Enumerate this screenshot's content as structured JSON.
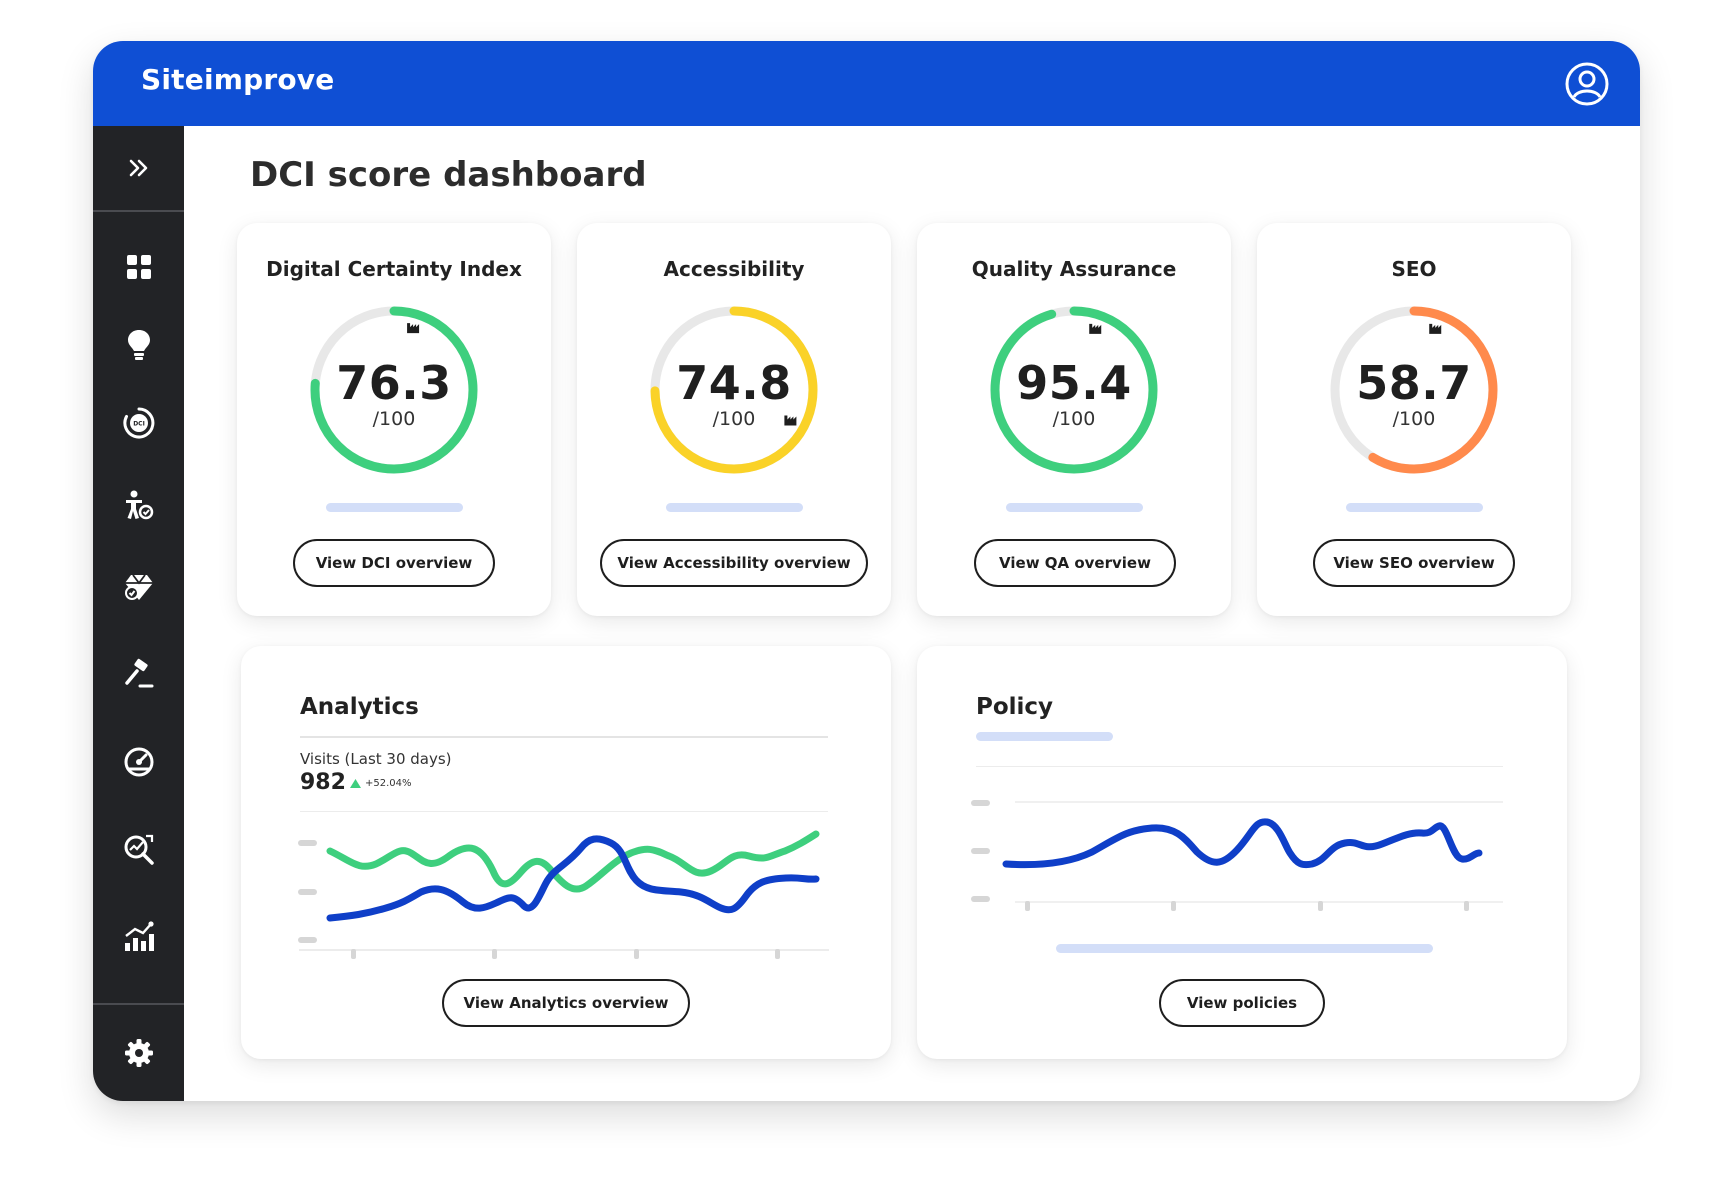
{
  "app": {
    "brand": "Siteimprove",
    "user_icon": "user-circle-icon",
    "brand_color": "#0f4fd4"
  },
  "sidebar": {
    "expand_icon": "double-chevron-right-icon",
    "items": [
      {
        "icon": "dashboard-grid-icon"
      },
      {
        "icon": "lightbulb-icon"
      },
      {
        "icon": "dci-icon",
        "text": "DCI"
      },
      {
        "icon": "accessibility-icon"
      },
      {
        "icon": "quality-assurance-icon"
      },
      {
        "icon": "policy-gavel-icon"
      },
      {
        "icon": "performance-gauge-icon"
      },
      {
        "icon": "seo-search-icon"
      },
      {
        "icon": "analytics-chart-icon"
      }
    ],
    "settings_icon": "gear-icon"
  },
  "page": {
    "title": "DCI score dashboard"
  },
  "score_cards": [
    {
      "title": "Digital Certainty Index",
      "score": "76.3",
      "max": "/100",
      "value": 76.3,
      "color": "#3ecf7e",
      "button": "View DCI overview"
    },
    {
      "title": "Accessibility",
      "score": "74.8",
      "max": "/100",
      "value": 74.8,
      "color": "#fad228",
      "button": "View Accessibility overview"
    },
    {
      "title": "Quality Assurance",
      "score": "95.4",
      "max": "/100",
      "value": 95.4,
      "color": "#3ecf7e",
      "button": "View QA overview"
    },
    {
      "title": "SEO",
      "score": "58.7",
      "max": "/100",
      "value": 58.7,
      "color": "#ff8a4c",
      "button": "View SEO overview"
    }
  ],
  "analytics": {
    "title": "Analytics",
    "visits_label": "Visits (Last 30 days)",
    "visits": "982",
    "change": "+52.04%",
    "change_color": "#3ecf7e",
    "button": "View Analytics overview"
  },
  "policy": {
    "title": "Policy",
    "button": "View policies"
  },
  "colors": {
    "series_blue": "#0f3fc8",
    "series_green": "#3ecf7e",
    "skeleton": "#d3def8"
  }
}
